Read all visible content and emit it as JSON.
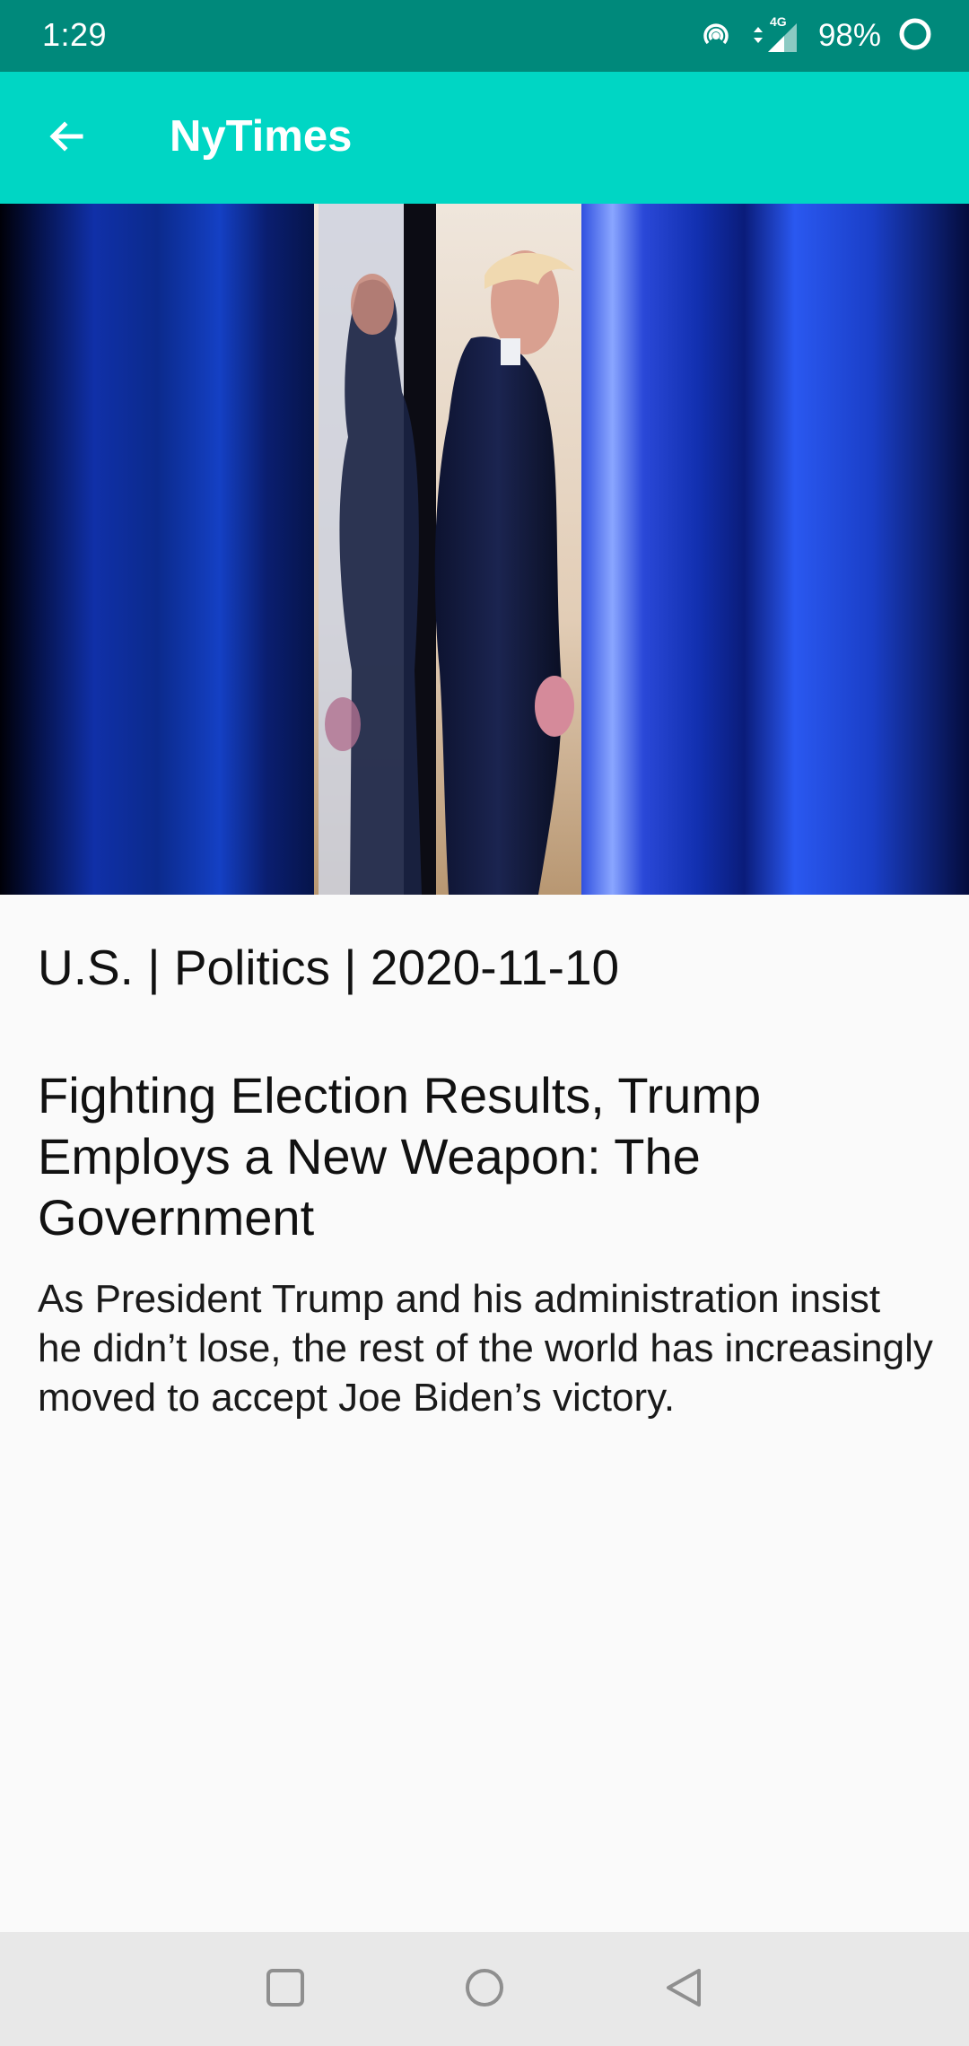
{
  "status_bar": {
    "time": "1:29",
    "network": "4G",
    "battery_percent": "98%",
    "icons": [
      "hotspot-icon",
      "data-arrows-icon",
      "signal-icon",
      "battery-ring-icon"
    ]
  },
  "app_bar": {
    "title": "NyTimes",
    "back_icon": "arrow-left-icon",
    "color": "#00d6c4",
    "status_color": "#00897b"
  },
  "article": {
    "meta": "U.S. | Politics | 2020-11-10",
    "title": "Fighting Election Results, Trump Employs a New Weapon: The Government",
    "abstract": "As President Trump and his administration insist he didn’t lose, the rest of the world has increasingly moved to accept Joe Biden’s victory."
  },
  "nav_bar": {
    "icons": [
      "recents-square-icon",
      "home-circle-icon",
      "back-triangle-icon"
    ]
  }
}
